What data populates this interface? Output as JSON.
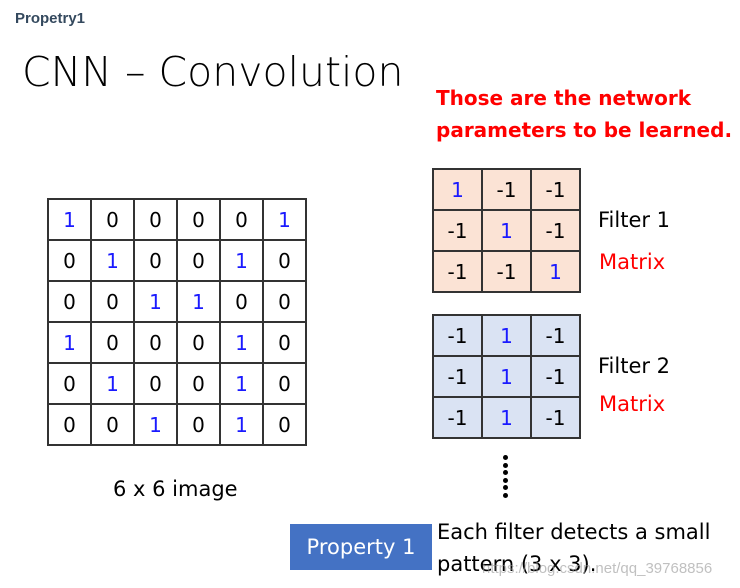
{
  "header": "Propetry1",
  "title": "CNN – Convolution",
  "note_lines": [
    "Those are the network",
    "parameters to be learned."
  ],
  "image": {
    "caption": "6 x 6 image",
    "matrix": [
      [
        "1",
        "0",
        "0",
        "0",
        "0",
        "1"
      ],
      [
        "0",
        "1",
        "0",
        "0",
        "1",
        "0"
      ],
      [
        "0",
        "0",
        "1",
        "1",
        "0",
        "0"
      ],
      [
        "1",
        "0",
        "0",
        "0",
        "1",
        "0"
      ],
      [
        "0",
        "1",
        "0",
        "0",
        "1",
        "0"
      ],
      [
        "0",
        "0",
        "1",
        "0",
        "1",
        "0"
      ]
    ]
  },
  "filters": [
    {
      "name": "Filter 1",
      "sublabel": "Matrix",
      "color": "#fbe3d5",
      "matrix": [
        [
          "1",
          "-1",
          "-1"
        ],
        [
          "-1",
          "1",
          "-1"
        ],
        [
          "-1",
          "-1",
          "1"
        ]
      ]
    },
    {
      "name": "Filter 2",
      "sublabel": "Matrix",
      "color": "#dae3f3",
      "matrix": [
        [
          "-1",
          "1",
          "-1"
        ],
        [
          "-1",
          "1",
          "-1"
        ],
        [
          "-1",
          "1",
          "-1"
        ]
      ]
    }
  ],
  "property_badge": "Property 1",
  "description_lines": [
    "Each filter detects a small",
    "pattern (3 x 3)."
  ],
  "watermark": "https://blog.csdn.net/qq_39768856",
  "colors": {
    "highlight_one": "#1a1aff",
    "note": "#ff0000",
    "badge": "#4472c4"
  }
}
